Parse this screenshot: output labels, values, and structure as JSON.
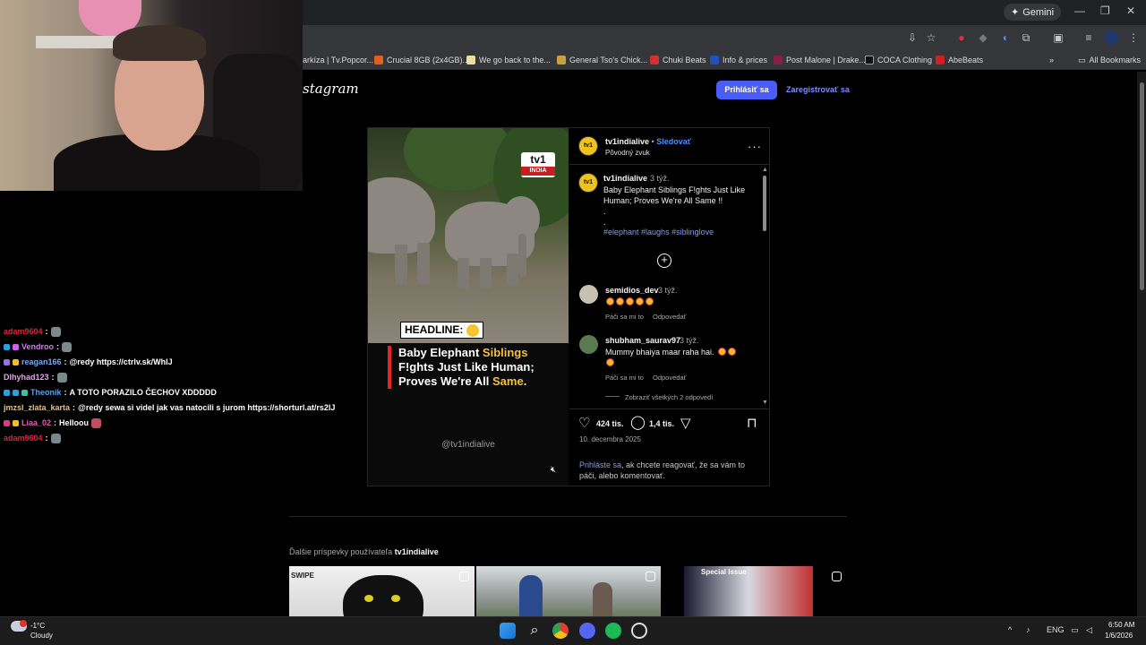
{
  "browser": {
    "gemini_label": "Gemini",
    "bookmarks": [
      {
        "label": "arkíza | Tv.Popcor...",
        "color": "#00000000"
      },
      {
        "label": "Crucial 8GB (2x4GB)...",
        "color": "#e06020"
      },
      {
        "label": "We go back to the...",
        "color": "#e8e0a0"
      },
      {
        "label": "General Tso's Chick...",
        "color": "#c8a040"
      },
      {
        "label": "Chuki Beats",
        "color": "#d03030"
      },
      {
        "label": "Info & prices",
        "color": "#2050c0"
      },
      {
        "label": "Post Malone | Drake...",
        "color": "#8a2040"
      },
      {
        "label": "COCA Clothing",
        "color": "#101010"
      },
      {
        "label": "AbeBeats",
        "color": "#d02020"
      }
    ],
    "all_bookmarks": "All Bookmarks"
  },
  "instagram": {
    "logo_text": "stagram",
    "login_button": "Prihlásiť sa",
    "register_link": "Zaregistrovať sa",
    "post": {
      "username": "tv1indialive",
      "follow_sep": " • ",
      "follow": "Sledovať",
      "audio": "Pôvodný zvuk",
      "avatar_text": "tv1",
      "caption_user": "tv1indialive",
      "caption_time": "3 týž.",
      "caption_line1": "Baby Elephant Siblings F!ghts Just Like",
      "caption_line2": "Human; Proves We're All Same !!",
      "caption_dot": ".",
      "tags": "#elephant #laughs #siblinglove",
      "media": {
        "logo_top": "tv1",
        "logo_bottom": "INDIA",
        "headline": "HEADLINE:",
        "line1_a": "Baby Elephant ",
        "line1_b": "Siblings",
        "line2": "F!ghts Just Like Human;",
        "line3_a": "Proves We're All ",
        "line3_b": "Same",
        "line3_c": ".",
        "handle": "@tv1indialive"
      },
      "comments": [
        {
          "user": "semidios_dev",
          "time": "3 týž.",
          "text": "",
          "emoji_count": 5,
          "like": "Páči sa mi to",
          "reply": "Odpovedať"
        },
        {
          "user": "shubham_saurav97",
          "time": "3 týž.",
          "text": "Mummy bhaiya maar raha hai.",
          "emoji_count": 3,
          "like": "Páči sa mi to",
          "reply": "Odpovedať"
        }
      ],
      "view_replies": "Zobraziť všetkých 2 odpovedí",
      "likes": "424 tis.",
      "comments_count": "1,4 tis.",
      "date": "10. decembra 2025",
      "login_link": "Prihláste sa",
      "login_rest": ", ak chcete reagovať, že sa vám to páči, alebo komentovať."
    },
    "more_posts_prefix": "Ďalšie príspevky používateľa ",
    "more_posts_user": "tv1indialive",
    "thumb1_label": "SWIPE",
    "thumb3_label": "Special Issue"
  },
  "chat": [
    {
      "user": "adam9604",
      "color": "#e0233a",
      "badges": [],
      "text": ""
    },
    {
      "user": "Vendroo",
      "color": "#d17cf0",
      "badges": [
        "#28a0e0",
        "#d060f0"
      ],
      "text": ""
    },
    {
      "user": "reagan166",
      "color": "#7aa8f0",
      "badges": [
        "#9a70e0",
        "#f0c020"
      ],
      "text": "@redy https://ctrlv.sk/WhlJ"
    },
    {
      "user": "Dlhyhad123",
      "color": "#e8a0f0",
      "badges": [],
      "text": ""
    },
    {
      "user": "Theonik",
      "color": "#5aa0e8",
      "badges": [
        "#28a0e0",
        "#28a0e0",
        "#40c0a0"
      ],
      "text": "A TOTO PORAZILO ČECHOV XDDDDD"
    },
    {
      "user": "jmzsl_zlata_karta",
      "color": "#f0c060",
      "badges": [],
      "text": "@redy sewa si videl jak vas natocili s jurom https://shorturl.at/rs2lJ"
    },
    {
      "user": "Liaa_02",
      "color": "#e060b0",
      "badges": [
        "#d04080",
        "#f0c020"
      ],
      "text": "Helloou"
    },
    {
      "user": "adam9604",
      "color": "#e0233a",
      "badges": [],
      "text": ""
    }
  ],
  "taskbar": {
    "temp": "-1°C",
    "condition": "Cloudy",
    "lang": "ENG",
    "time": "6:50 AM",
    "date": "1/6/2026"
  }
}
